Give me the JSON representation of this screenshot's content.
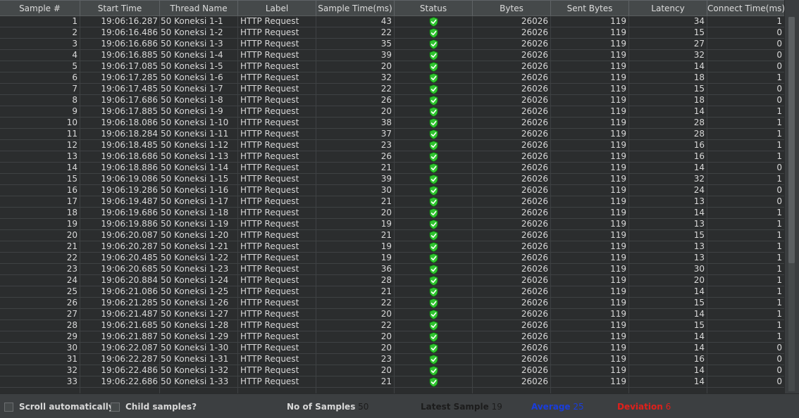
{
  "table": {
    "columns": [
      "Sample #",
      "Start Time",
      "Thread Name",
      "Label",
      "Sample Time(ms)",
      "Status",
      "Bytes",
      "Sent Bytes",
      "Latency",
      "Connect Time(ms)"
    ],
    "rows": [
      [
        "1",
        "19:06:16.287",
        "50 Koneksi 1-1",
        "HTTP Request",
        "43",
        "success",
        "26026",
        "119",
        "34",
        "1"
      ],
      [
        "2",
        "19:06:16.486",
        "50 Koneksi 1-2",
        "HTTP Request",
        "22",
        "success",
        "26026",
        "119",
        "15",
        "0"
      ],
      [
        "3",
        "19:06:16.686",
        "50 Koneksi 1-3",
        "HTTP Request",
        "35",
        "success",
        "26026",
        "119",
        "27",
        "0"
      ],
      [
        "4",
        "19:06:16.885",
        "50 Koneksi 1-4",
        "HTTP Request",
        "39",
        "success",
        "26026",
        "119",
        "32",
        "0"
      ],
      [
        "5",
        "19:06:17.085",
        "50 Koneksi 1-5",
        "HTTP Request",
        "20",
        "success",
        "26026",
        "119",
        "14",
        "0"
      ],
      [
        "6",
        "19:06:17.285",
        "50 Koneksi 1-6",
        "HTTP Request",
        "32",
        "success",
        "26026",
        "119",
        "18",
        "1"
      ],
      [
        "7",
        "19:06:17.485",
        "50 Koneksi 1-7",
        "HTTP Request",
        "22",
        "success",
        "26026",
        "119",
        "15",
        "0"
      ],
      [
        "8",
        "19:06:17.686",
        "50 Koneksi 1-8",
        "HTTP Request",
        "26",
        "success",
        "26026",
        "119",
        "18",
        "0"
      ],
      [
        "9",
        "19:06:17.885",
        "50 Koneksi 1-9",
        "HTTP Request",
        "20",
        "success",
        "26026",
        "119",
        "14",
        "1"
      ],
      [
        "10",
        "19:06:18.086",
        "50 Koneksi 1-10",
        "HTTP Request",
        "38",
        "success",
        "26026",
        "119",
        "28",
        "1"
      ],
      [
        "11",
        "19:06:18.284",
        "50 Koneksi 1-11",
        "HTTP Request",
        "37",
        "success",
        "26026",
        "119",
        "28",
        "1"
      ],
      [
        "12",
        "19:06:18.485",
        "50 Koneksi 1-12",
        "HTTP Request",
        "23",
        "success",
        "26026",
        "119",
        "16",
        "1"
      ],
      [
        "13",
        "19:06:18.686",
        "50 Koneksi 1-13",
        "HTTP Request",
        "26",
        "success",
        "26026",
        "119",
        "16",
        "1"
      ],
      [
        "14",
        "19:06:18.886",
        "50 Koneksi 1-14",
        "HTTP Request",
        "21",
        "success",
        "26026",
        "119",
        "14",
        "0"
      ],
      [
        "15",
        "19:06:19.086",
        "50 Koneksi 1-15",
        "HTTP Request",
        "39",
        "success",
        "26026",
        "119",
        "32",
        "1"
      ],
      [
        "16",
        "19:06:19.286",
        "50 Koneksi 1-16",
        "HTTP Request",
        "30",
        "success",
        "26026",
        "119",
        "24",
        "0"
      ],
      [
        "17",
        "19:06:19.487",
        "50 Koneksi 1-17",
        "HTTP Request",
        "21",
        "success",
        "26026",
        "119",
        "13",
        "0"
      ],
      [
        "18",
        "19:06:19.686",
        "50 Koneksi 1-18",
        "HTTP Request",
        "20",
        "success",
        "26026",
        "119",
        "14",
        "1"
      ],
      [
        "19",
        "19:06:19.886",
        "50 Koneksi 1-19",
        "HTTP Request",
        "19",
        "success",
        "26026",
        "119",
        "13",
        "1"
      ],
      [
        "20",
        "19:06:20.087",
        "50 Koneksi 1-20",
        "HTTP Request",
        "21",
        "success",
        "26026",
        "119",
        "15",
        "1"
      ],
      [
        "21",
        "19:06:20.287",
        "50 Koneksi 1-21",
        "HTTP Request",
        "19",
        "success",
        "26026",
        "119",
        "13",
        "1"
      ],
      [
        "22",
        "19:06:20.485",
        "50 Koneksi 1-22",
        "HTTP Request",
        "19",
        "success",
        "26026",
        "119",
        "13",
        "1"
      ],
      [
        "23",
        "19:06:20.685",
        "50 Koneksi 1-23",
        "HTTP Request",
        "36",
        "success",
        "26026",
        "119",
        "30",
        "1"
      ],
      [
        "24",
        "19:06:20.884",
        "50 Koneksi 1-24",
        "HTTP Request",
        "28",
        "success",
        "26026",
        "119",
        "20",
        "1"
      ],
      [
        "25",
        "19:06:21.086",
        "50 Koneksi 1-25",
        "HTTP Request",
        "21",
        "success",
        "26026",
        "119",
        "14",
        "1"
      ],
      [
        "26",
        "19:06:21.285",
        "50 Koneksi 1-26",
        "HTTP Request",
        "22",
        "success",
        "26026",
        "119",
        "15",
        "1"
      ],
      [
        "27",
        "19:06:21.487",
        "50 Koneksi 1-27",
        "HTTP Request",
        "20",
        "success",
        "26026",
        "119",
        "14",
        "1"
      ],
      [
        "28",
        "19:06:21.685",
        "50 Koneksi 1-28",
        "HTTP Request",
        "22",
        "success",
        "26026",
        "119",
        "15",
        "1"
      ],
      [
        "29",
        "19:06:21.887",
        "50 Koneksi 1-29",
        "HTTP Request",
        "20",
        "success",
        "26026",
        "119",
        "14",
        "1"
      ],
      [
        "30",
        "19:06:22.087",
        "50 Koneksi 1-30",
        "HTTP Request",
        "20",
        "success",
        "26026",
        "119",
        "14",
        "0"
      ],
      [
        "31",
        "19:06:22.287",
        "50 Koneksi 1-31",
        "HTTP Request",
        "23",
        "success",
        "26026",
        "119",
        "16",
        "0"
      ],
      [
        "32",
        "19:06:22.486",
        "50 Koneksi 1-32",
        "HTTP Request",
        "20",
        "success",
        "26026",
        "119",
        "14",
        "0"
      ],
      [
        "33",
        "19:06:22.686",
        "50 Koneksi 1-33",
        "HTTP Request",
        "21",
        "success",
        "26026",
        "119",
        "14",
        "0"
      ]
    ]
  },
  "status_icon": "green-shield-check-icon",
  "colors": {
    "average": "#1a3ddb",
    "deviation": "#e0201b",
    "success_icon": "#2fc42f"
  },
  "footer": {
    "scroll_auto_label": "Scroll automatically?",
    "child_samples_label": "Child samples?",
    "no_of_samples_label": "No of Samples",
    "no_of_samples_value": "50",
    "latest_sample_label": "Latest Sample",
    "latest_sample_value": "19",
    "average_label": "Average",
    "average_value": "25",
    "deviation_label": "Deviation",
    "deviation_value": "6"
  }
}
